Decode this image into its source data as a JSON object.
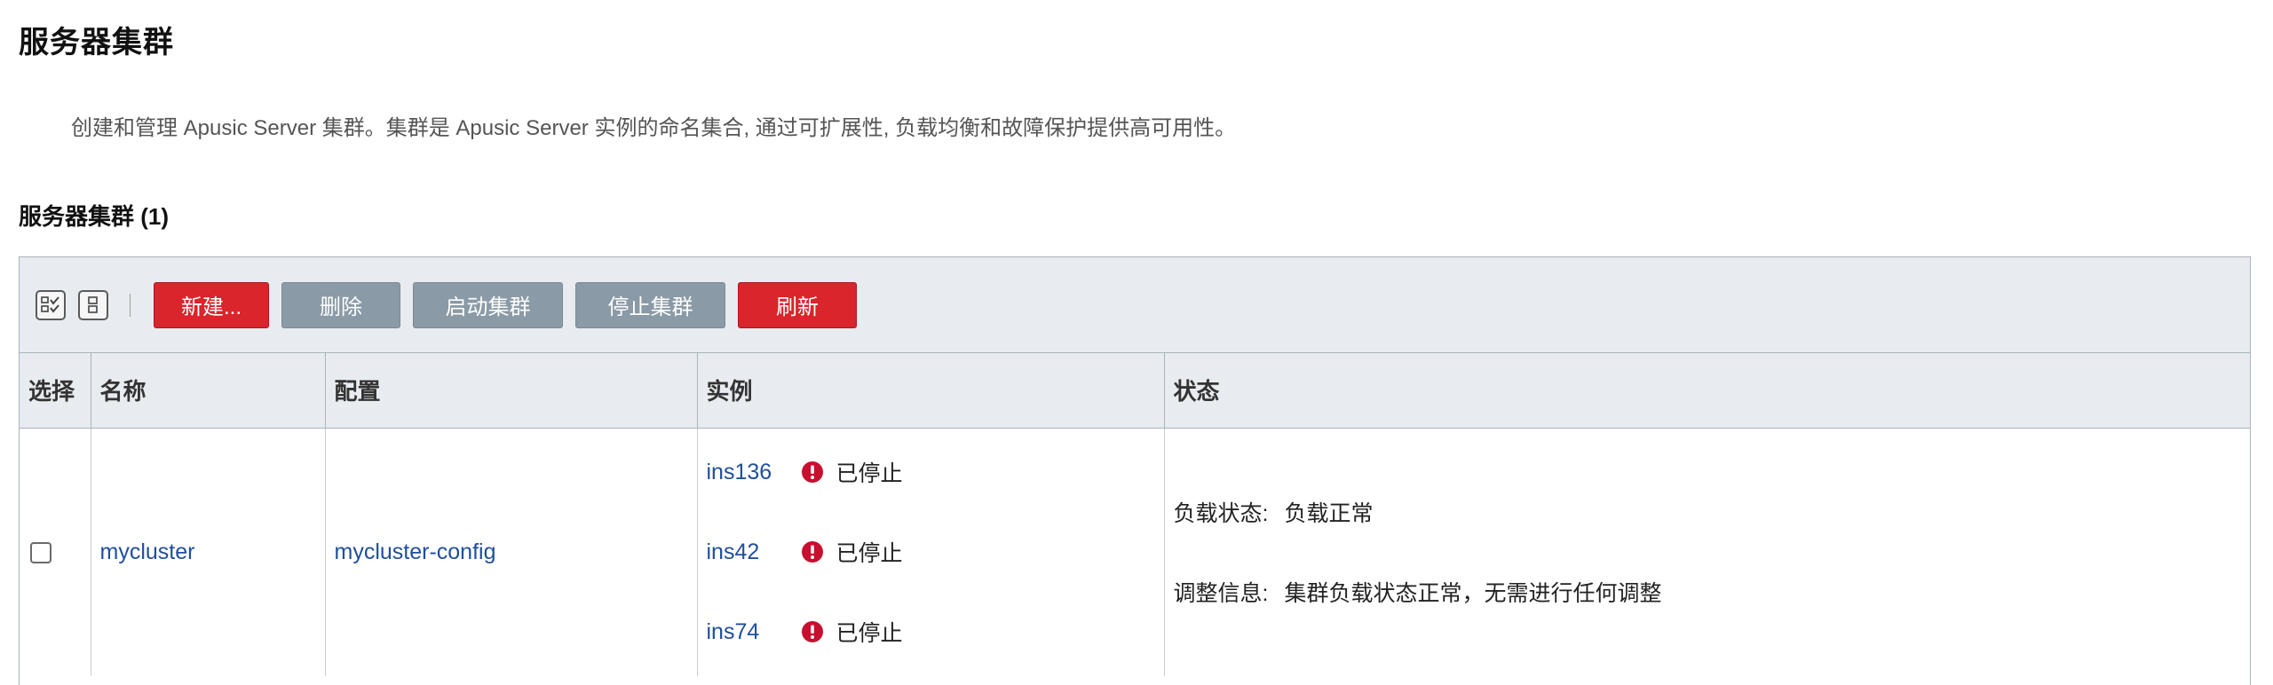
{
  "page": {
    "title": "服务器集群",
    "description": "创建和管理 Apusic Server 集群。集群是 Apusic Server 实例的命名集合, 通过可扩展性, 负载均衡和故障保护提供高可用性。"
  },
  "section": {
    "title": "服务器集群 (1)"
  },
  "toolbar": {
    "select_all_icon": "select-all-icon",
    "deselect_all_icon": "deselect-all-icon",
    "buttons": {
      "new": "新建...",
      "delete": "删除",
      "start": "启动集群",
      "stop": "停止集群",
      "refresh": "刷新"
    }
  },
  "table": {
    "headers": {
      "select": "选择",
      "name": "名称",
      "config": "配置",
      "instances": "实例",
      "status": "状态"
    },
    "rows": [
      {
        "name": "mycluster",
        "config": "mycluster-config",
        "instances": [
          {
            "name": "ins136",
            "status": "已停止",
            "status_icon": "error-icon"
          },
          {
            "name": "ins42",
            "status": "已停止",
            "status_icon": "error-icon"
          },
          {
            "name": "ins74",
            "status": "已停止",
            "status_icon": "error-icon"
          }
        ],
        "status": {
          "load_label": "负载状态:",
          "load_value": "负载正常",
          "adjust_label": "调整信息:",
          "adjust_value": "集群负载状态正常，无需进行任何调整"
        }
      }
    ]
  },
  "colors": {
    "primary_button": "#d9252b",
    "secondary_button": "#8a9aa6",
    "header_bg": "#e8ecf0",
    "link": "#1f4e9c",
    "error_icon": "#c8102e"
  }
}
